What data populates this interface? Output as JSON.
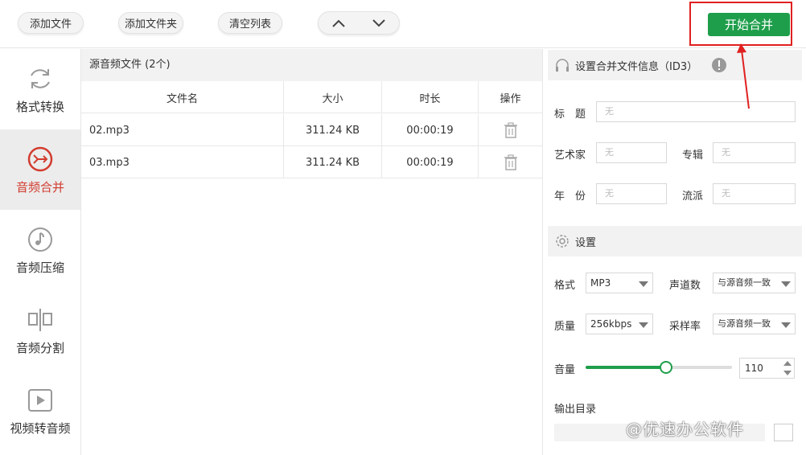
{
  "toolbar": {
    "add_file": "添加文件",
    "add_folder": "添加文件夹",
    "clear_list": "清空列表",
    "start_merge": "开始合并",
    "accent_color": "#1e9e4a",
    "highlight_color": "#e02020"
  },
  "sidebar": {
    "items": [
      {
        "label": "格式转换",
        "icon": "refresh-icon",
        "active": false
      },
      {
        "label": "音频合并",
        "icon": "merge-icon",
        "active": true
      },
      {
        "label": "音频压缩",
        "icon": "music-note-icon",
        "active": false
      },
      {
        "label": "音频分割",
        "icon": "split-icon",
        "active": false
      },
      {
        "label": "视频转音频",
        "icon": "play-video-icon",
        "active": false
      }
    ]
  },
  "file_list": {
    "title": "源音频文件 (2个)",
    "columns": [
      "文件名",
      "大小",
      "时长",
      "操作"
    ],
    "rows": [
      {
        "name": "02.mp3",
        "size": "311.24 KB",
        "duration": "00:00:19"
      },
      {
        "name": "03.mp3",
        "size": "311.24 KB",
        "duration": "00:00:19"
      }
    ]
  },
  "id3": {
    "header": "设置合并文件信息（ID3）",
    "title_label": "标　题",
    "title_placeholder": "无",
    "artist_label": "艺术家",
    "artist_placeholder": "无",
    "album_label": "专辑",
    "album_placeholder": "无",
    "year_label": "年　份",
    "year_placeholder": "无",
    "genre_label": "流派",
    "genre_placeholder": "无"
  },
  "settings": {
    "header": "设置",
    "format_label": "格式",
    "format_value": "MP3",
    "channels_label": "声道数",
    "channels_value": "与源音频一致",
    "quality_label": "质量",
    "quality_value": "256kbps",
    "samplerate_label": "采样率",
    "samplerate_value": "与源音频一致",
    "volume_label": "音量",
    "volume_value": "110",
    "volume_fraction": 0.55,
    "output_label": "输出目录"
  },
  "watermark": "@优速办公软件"
}
